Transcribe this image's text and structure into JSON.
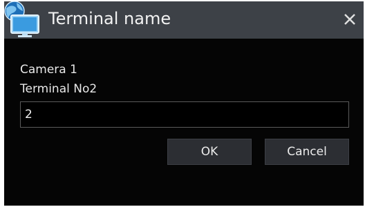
{
  "window": {
    "title": "Terminal name",
    "close_icon": "close-icon",
    "app_icon": "network-terminal-icon"
  },
  "form": {
    "camera_label": "Camera 1",
    "terminal_label": "Terminal No2",
    "terminal_value": "2"
  },
  "buttons": {
    "ok_label": "OK",
    "cancel_label": "Cancel"
  },
  "colors": {
    "titlebar": "#3d4147",
    "background": "#050505",
    "button": "#2c2e33",
    "text": "#e8e8e8"
  }
}
